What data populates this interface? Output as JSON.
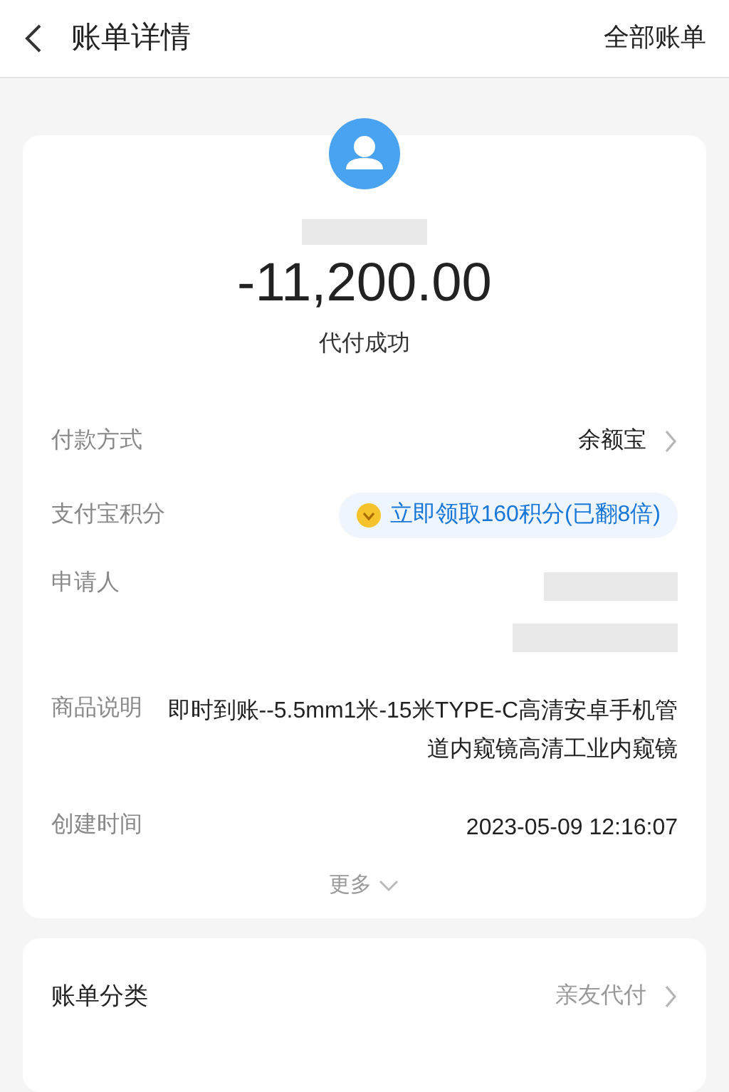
{
  "header": {
    "title": "账单详情",
    "action": "全部账单"
  },
  "summary": {
    "amount": "-11,200.00",
    "status": "代付成功"
  },
  "details": [
    {
      "kind": "link",
      "label": "付款方式",
      "value": "余额宝",
      "muted": false
    },
    {
      "kind": "points",
      "label": "支付宝积分",
      "value": "立即领取160积分(已翻8倍)"
    },
    {
      "kind": "redacted",
      "label": "申请人"
    },
    {
      "kind": "text",
      "label": "商品说明",
      "value": "即时到账--5.5mm1米-15米TYPE-C高清安卓手机管道内窥镜高清工业内窥镜"
    },
    {
      "kind": "text",
      "label": "创建时间",
      "value": "2023-05-09 12:16:07"
    }
  ],
  "more": "更多",
  "category": [
    {
      "kind": "link",
      "label": "账单分类",
      "value": "亲友代付",
      "muted": true
    }
  ]
}
